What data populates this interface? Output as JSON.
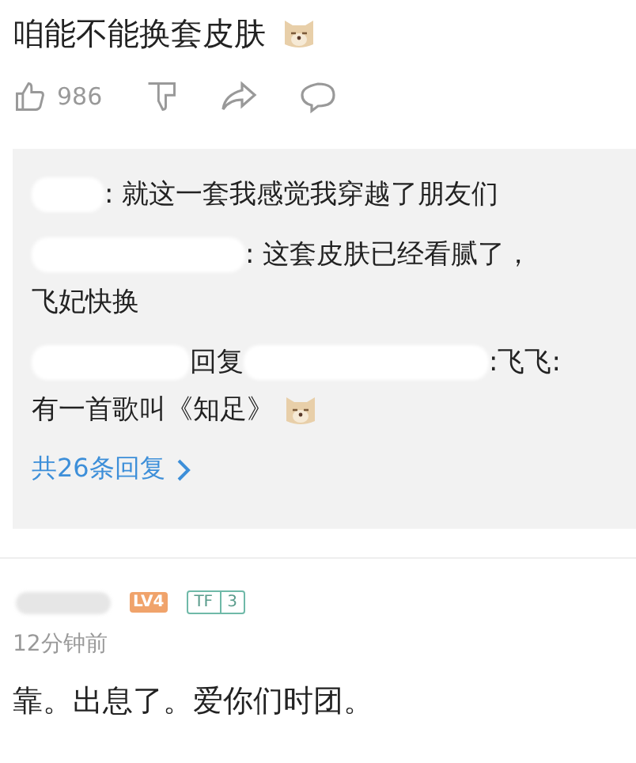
{
  "post": {
    "text": "咱能不能换套皮肤",
    "emoji": true
  },
  "actions": [
    {
      "kind": "like",
      "count": "986"
    },
    {
      "kind": "dislike"
    },
    {
      "kind": "share"
    },
    {
      "kind": "comment"
    }
  ],
  "replies": [
    {
      "kind": "plain",
      "lines": [
        ": 就这一套我感觉我穿越了朋友们"
      ]
    },
    {
      "kind": "plain",
      "lines": [
        ": 这套皮肤已经看腻了，",
        "飞妃快换"
      ]
    },
    {
      "kind": "reply_to",
      "verb": "回复",
      "lines": [
        ":飞飞:",
        "有一首歌叫《知足》"
      ],
      "emoji": true
    }
  ],
  "more_replies": "共26条回复",
  "comment": {
    "level_badge": "LV4",
    "fan_badge": {
      "label": "TF",
      "value": "3"
    },
    "time": "12分钟前",
    "text": "靠。出息了。爱你们时团。"
  }
}
